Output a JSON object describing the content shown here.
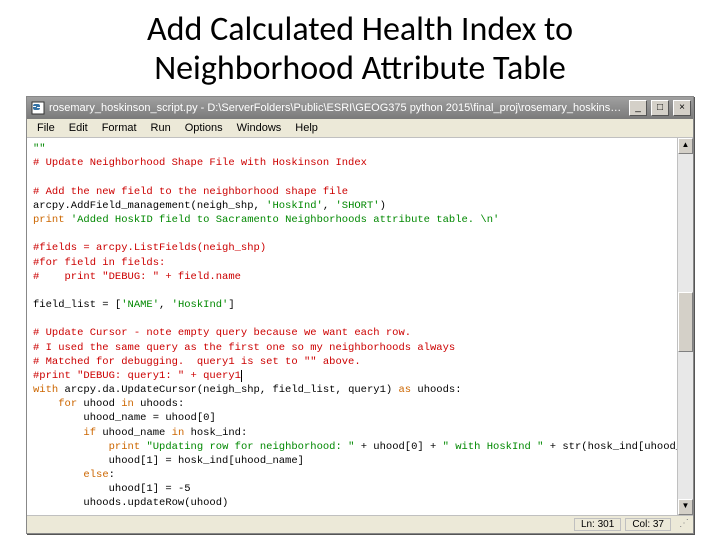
{
  "slide": {
    "title_line1": "Add Calculated Health Index to",
    "title_line2": "Neighborhood Attribute Table"
  },
  "window": {
    "icon_name": "python-file-icon",
    "title": "rosemary_hoskinson_script.py - D:\\ServerFolders\\Public\\ESRI\\GEOG375 python 2015\\final_proj\\rosemary_hoskinson_script.py",
    "controls": {
      "minimize": "_",
      "maximize": "□",
      "close": "×"
    }
  },
  "menu": {
    "items": [
      "File",
      "Edit",
      "Format",
      "Run",
      "Options",
      "Windows",
      "Help"
    ]
  },
  "code": {
    "l00": "\"\"",
    "l01": "# Update Neighborhood Shape File with Hoskinson Index",
    "l02": "",
    "l03": "# Add the new field to the neighborhood shape file",
    "l04a": "arcpy.AddField_management(neigh_shp, ",
    "l04b": "'HoskInd'",
    "l04c": ", ",
    "l04d": "'SHORT'",
    "l04e": ")",
    "l05a": "print",
    "l05b": " ",
    "l05c": "'Added HoskID field to Sacramento Neighborhoods attribute table. \\n'",
    "l06": "",
    "l07": "#fields = arcpy.ListFields(neigh_shp)",
    "l08": "#for field in fields:",
    "l09": "#    print \"DEBUG: \" + field.name",
    "l10": "",
    "l11a": "field_list = [",
    "l11b": "'NAME'",
    "l11c": ", ",
    "l11d": "'HoskInd'",
    "l11e": "]",
    "l12": "",
    "l13": "# Update Cursor - note empty query because we want each row.",
    "l14": "# I used the same query as the first one so my neighborhoods always",
    "l15": "# Matched for debugging.  query1 is set to \"\" above.",
    "l16": "#print \"DEBUG: query1: \" + query1",
    "l17a": "with",
    "l17b": " arcpy.da.UpdateCursor(neigh_shp, field_list, query1) ",
    "l17c": "as",
    "l17d": " uhoods:",
    "l18a": "    ",
    "l18b": "for",
    "l18c": " uhood ",
    "l18d": "in",
    "l18e": " uhoods:",
    "l19a": "        uhood_name = uhood[",
    "l19b": "0",
    "l19c": "]",
    "l20a": "        ",
    "l20b": "if",
    "l20c": " uhood_name ",
    "l20d": "in",
    "l20e": " hosk_ind:",
    "l21a": "            ",
    "l21b": "print",
    "l21c": " ",
    "l21d": "\"Updating row for neighborhood: \"",
    "l21e": " + uhood[",
    "l21f": "0",
    "l21g": "] + ",
    "l21h": "\" with HoskInd \"",
    "l21i": " + str(hosk_ind[uhood_name])",
    "l22a": "            uhood[",
    "l22b": "1",
    "l22c": "] = hosk_ind[uhood_name]",
    "l23a": "        ",
    "l23b": "else",
    "l23c": ":",
    "l24a": "            uhood[",
    "l24b": "1",
    "l24c": "] = -",
    "l24d": "5",
    "l25": "        uhoods.updateRow(uhood)"
  },
  "status": {
    "line": "Ln: 301",
    "col": "Col: 37"
  },
  "arrows": {
    "up": "▲",
    "down": "▼"
  },
  "grip": "⋰"
}
